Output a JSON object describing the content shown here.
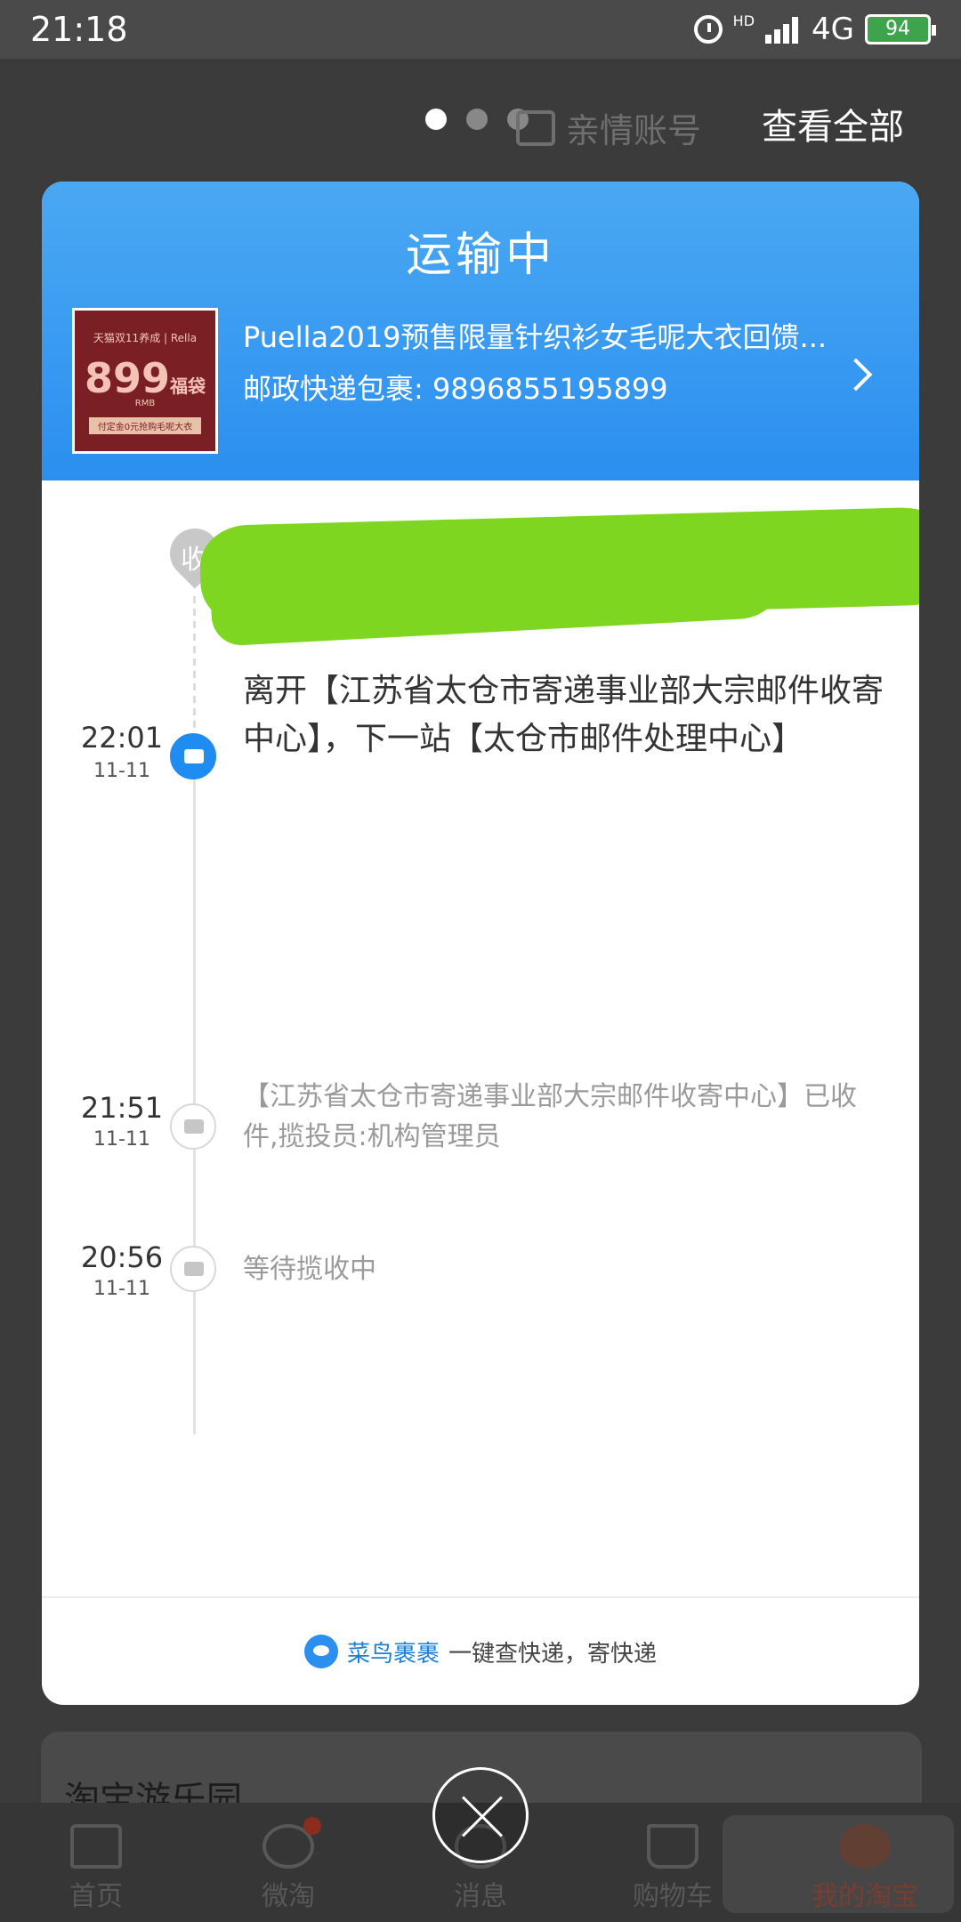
{
  "status_bar": {
    "time": "21:18",
    "network": "4G",
    "hd": "HD",
    "battery": "94"
  },
  "background": {
    "family_account": "亲情账号",
    "view_all": "查看全部",
    "playground_title": "淘宝游乐园",
    "tabs": [
      {
        "label": "首页",
        "icon": "home-icon"
      },
      {
        "label": "微淘",
        "icon": "weitao-icon"
      },
      {
        "label": "消息",
        "icon": "message-icon"
      },
      {
        "label": "购物车",
        "icon": "cart-icon"
      },
      {
        "label": "我的淘宝",
        "icon": "avatar-icon"
      }
    ]
  },
  "modal": {
    "title": "运输中",
    "product": {
      "name": "Puella2019预售限量针织衫女毛呢大衣回馈...",
      "thumb_top": "天猫双11养成 | Rella",
      "thumb_price": "899",
      "thumb_price_tag": "福袋",
      "thumb_currency": "RMB",
      "thumb_bottom": "付定金0元抢购毛呢大衣"
    },
    "tracking": "邮政快递包裹: 9896855195899",
    "receive_marker": "收",
    "events": [
      {
        "time": "22:01",
        "date": "11-11",
        "desc": "离开【江苏省太仓市寄递事业部大宗邮件收寄中心】，下一站【太仓市邮件处理中心】"
      },
      {
        "time": "21:51",
        "date": "11-11",
        "desc": "【江苏省太仓市寄递事业部大宗邮件收寄中心】已收件,揽投员:机构管理员"
      },
      {
        "time": "20:56",
        "date": "11-11",
        "desc": "等待揽收中"
      }
    ],
    "footer": {
      "link": "菜鸟裹裹",
      "text": "一键查快递，寄快递"
    }
  }
}
